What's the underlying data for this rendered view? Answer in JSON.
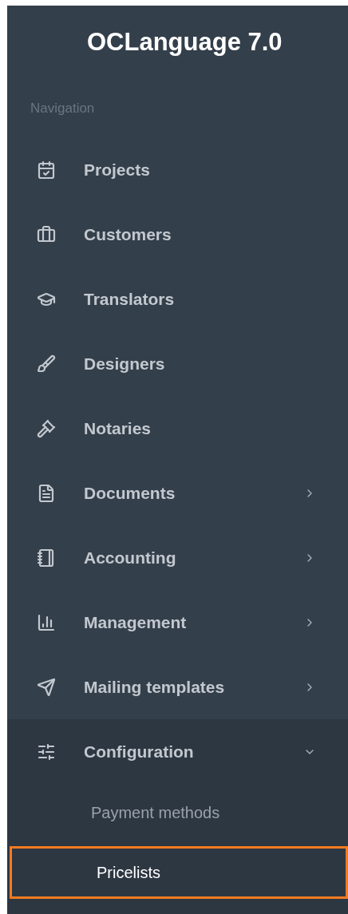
{
  "brand": {
    "title": "OCLanguage 7.0"
  },
  "navigation": {
    "heading": "Navigation",
    "items": [
      {
        "label": "Projects"
      },
      {
        "label": "Customers"
      },
      {
        "label": "Translators"
      },
      {
        "label": "Designers"
      },
      {
        "label": "Notaries"
      },
      {
        "label": "Documents",
        "expanded": false
      },
      {
        "label": "Accounting",
        "expanded": false
      },
      {
        "label": "Management",
        "expanded": false
      },
      {
        "label": "Mailing templates",
        "expanded": false
      },
      {
        "label": "Configuration",
        "expanded": true,
        "children": [
          {
            "label": "Payment methods",
            "selected": false
          },
          {
            "label": "Pricelists",
            "selected": true
          }
        ]
      }
    ]
  }
}
